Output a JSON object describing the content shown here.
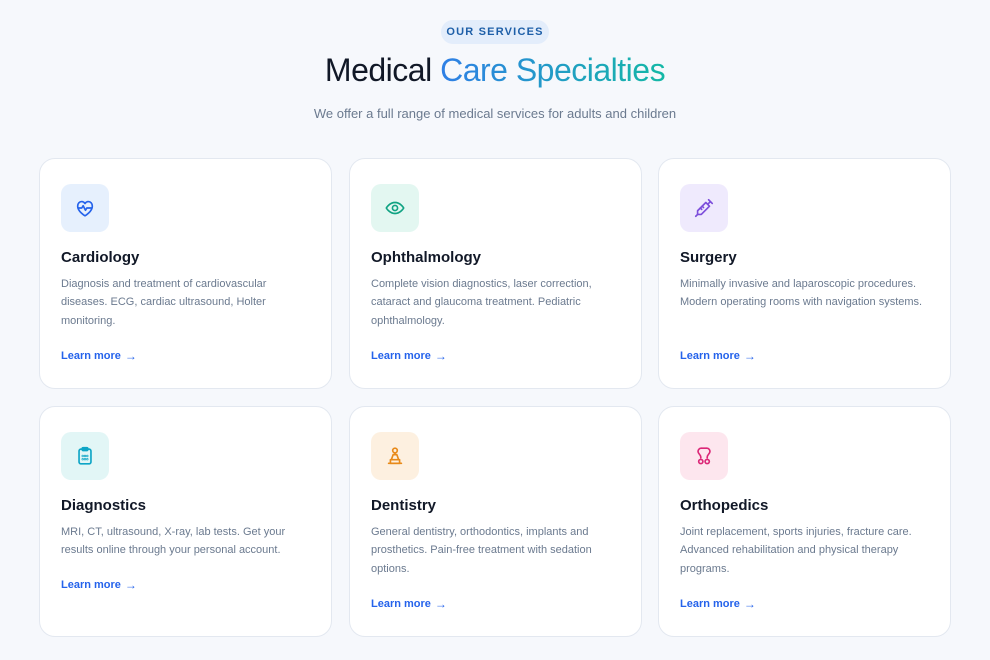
{
  "header": {
    "badge": "OUR SERVICES",
    "title_main": "Medical",
    "title_accent": "Care Specialties",
    "subtitle": "We offer a full range of medical services for adults and children"
  },
  "colors": {
    "accent_blue": "#2563eb",
    "accent_teal": "#14b8a6",
    "card_border": "#e3e8f0",
    "background": "#f6f8fc"
  },
  "cards": [
    {
      "title": "Cardiology",
      "description": "Diagnosis and treatment of cardiovascular diseases. ECG, cardiac ultrasound, Holter monitoring.",
      "link": "Learn more",
      "arrow": "→",
      "icon": "heart-pulse-icon",
      "icon_bg": "#e6f0fd",
      "icon_color": "#2563eb"
    },
    {
      "title": "Ophthalmology",
      "description": "Complete vision diagnostics, laser correction, cataract and glaucoma treatment. Pediatric ophthalmology.",
      "link": "Learn more",
      "arrow": "→",
      "icon": "eye-icon",
      "icon_bg": "#e3f7f1",
      "icon_color": "#10a383"
    },
    {
      "title": "Surgery",
      "description": "Minimally invasive and laparoscopic procedures. Modern operating rooms with navigation systems.",
      "link": "Learn more",
      "arrow": "→",
      "icon": "syringe-icon",
      "icon_bg": "#efeafd",
      "icon_color": "#7c4ddb"
    },
    {
      "title": "Diagnostics",
      "description": "MRI, CT, ultrasound, X-ray, lab tests. Get your results online through your personal account.",
      "link": "Learn more",
      "arrow": "→",
      "icon": "clipboard-icon",
      "icon_bg": "#e2f6f6",
      "icon_color": "#0ea5c6"
    },
    {
      "title": "Dentistry",
      "description": "General dentistry, orthodontics, implants and prosthetics. Pain-free treatment with sedation options.",
      "link": "Learn more",
      "arrow": "→",
      "icon": "tooth-icon",
      "icon_bg": "#fdf0e0",
      "icon_color": "#e88a1a"
    },
    {
      "title": "Orthopedics",
      "description": "Joint replacement, sports injuries, fracture care. Advanced rehabilitation and physical therapy programs.",
      "link": "Learn more",
      "arrow": "→",
      "icon": "bone-icon",
      "icon_bg": "#fde6ee",
      "icon_color": "#db2777"
    }
  ]
}
